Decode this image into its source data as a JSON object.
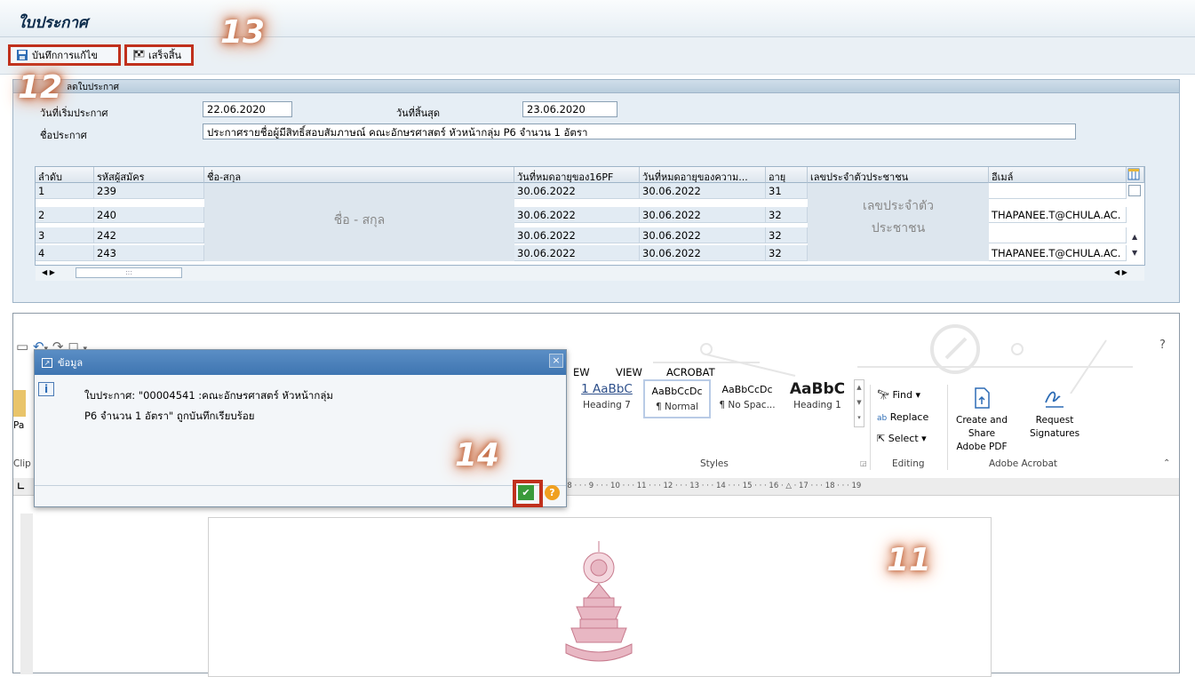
{
  "screen": {
    "title": "ใบประกาศ"
  },
  "toolbar": {
    "save_label": "บันทึกการแก้ไข",
    "finish_label": "เสร็จสิ้น"
  },
  "callouts": {
    "c11": "11",
    "c12": "12",
    "c13": "13",
    "c14": "14"
  },
  "details": {
    "group_title": "ลดใบประกาศ",
    "start_label": "วันที่เริ่มประกาศ",
    "start_value": "22.06.2020",
    "end_label": "วันที่สิ้นสุด",
    "end_value": "23.06.2020",
    "name_label": "ชื่อประกาศ",
    "name_value": "ประกาศรายชื่อผู้มีสิทธิ์สอบสัมภาษณ์ คณะอักษรศาสตร์ หัวหน้ากลุ่ม P6 จำนวน 1 อัตรา"
  },
  "table": {
    "columns": [
      "ลำดับ",
      "รหัสผู้สมัคร",
      "ชื่อ-สกุล",
      "วันที่หมดอายุของ16PF",
      "วันที่หมดอายุของความ...",
      "อายุ",
      "เลขประจำตัวประชาชน",
      "อีเมล์"
    ],
    "rows": [
      {
        "seq": "1",
        "id": "239",
        "exp16": "30.06.2022",
        "expb": "30.06.2022",
        "age": "31",
        "email": ""
      },
      {
        "seq": "2",
        "id": "240",
        "exp16": "30.06.2022",
        "expb": "30.06.2022",
        "age": "32",
        "email": "THAPANEE.T@CHULA.AC."
      },
      {
        "seq": "3",
        "id": "242",
        "exp16": "30.06.2022",
        "expb": "30.06.2022",
        "age": "32",
        "email": ""
      },
      {
        "seq": "4",
        "id": "243",
        "exp16": "30.06.2022",
        "expb": "30.06.2022",
        "age": "32",
        "email": "THAPANEE.T@CHULA.AC."
      }
    ],
    "name_overlay": "ชื่อ - สกุล",
    "id_overlay_1": "เลขประจำตัว",
    "id_overlay_2": "ประชาชน",
    "hscroll": ":::"
  },
  "word": {
    "tabs": {
      "view_part": "EW",
      "view": "VIEW",
      "acrobat": "ACROBAT"
    },
    "paste_part": "Pa",
    "clip_part": "Clip",
    "styles": [
      {
        "preview": "1  AaBbC",
        "name": "Heading 7"
      },
      {
        "preview": "AaBbCcDc",
        "name": "¶ Normal"
      },
      {
        "preview": "AaBbCcDc",
        "name": "¶ No Spac..."
      },
      {
        "preview": "AaBbC",
        "name": "Heading 1"
      }
    ],
    "styles_group": "Styles",
    "editing": {
      "find": "Find",
      "replace": "Replace",
      "select": "Select",
      "group": "Editing"
    },
    "acrobat": {
      "create": "Create and Share",
      "create2": "Adobe PDF",
      "request": "Request",
      "request2": "Signatures",
      "group": "Adobe Acrobat"
    },
    "ruler": "·  8 ·  ·  ·  9 ·  ·  · 10 ·  ·  · 11 ·  ·  · 12 ·  ·  · 13 ·  ·  · 14 ·  ·  · 15 ·  ·  · 16 ·  △  · 17 ·  ·  · 18 ·  ·  · 19",
    "help": "?"
  },
  "dialog": {
    "title": "ข้อมูล",
    "message_line1": "ใบประกาศ: \"00004541 :คณะอักษรศาสตร์ หัวหน้ากลุ่ม",
    "message_line2": "P6 จำนวน 1 อัตรา\" ถูกบันทึกเรียบร้อย",
    "close": "×",
    "info_symbol": "i",
    "ok_symbol": "✔",
    "help_symbol": "?"
  },
  "colors": {
    "accent": "#c0301c",
    "glow": "#c0633a",
    "dialog_header": "#3e75b1"
  }
}
